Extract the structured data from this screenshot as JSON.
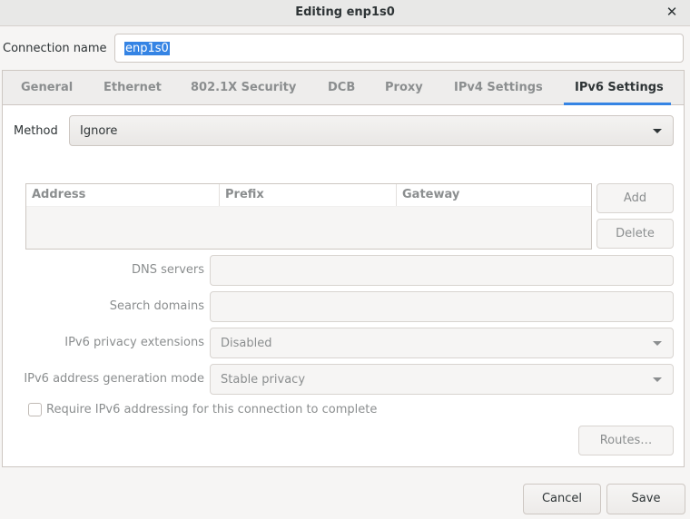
{
  "window": {
    "title": "Editing enp1s0"
  },
  "connection": {
    "label": "Connection name",
    "value": "enp1s0"
  },
  "tabs": [
    {
      "label": "General"
    },
    {
      "label": "Ethernet"
    },
    {
      "label": "802.1X Security"
    },
    {
      "label": "DCB"
    },
    {
      "label": "Proxy"
    },
    {
      "label": "IPv4 Settings"
    },
    {
      "label": "IPv6 Settings",
      "active": true
    }
  ],
  "method": {
    "label": "Method",
    "value": "Ignore"
  },
  "addresses": {
    "columns": [
      "Address",
      "Prefix",
      "Gateway"
    ],
    "add_label": "Add",
    "delete_label": "Delete"
  },
  "dns": {
    "label": "DNS servers",
    "value": ""
  },
  "search_domains": {
    "label": "Search domains",
    "value": ""
  },
  "privacy": {
    "label": "IPv6 privacy extensions",
    "value": "Disabled"
  },
  "addr_gen": {
    "label": "IPv6 address generation mode",
    "value": "Stable privacy"
  },
  "require": {
    "label": "Require IPv6 addressing for this connection to complete",
    "checked": false
  },
  "routes_label": "Routes…",
  "footer": {
    "cancel_label": "Cancel",
    "save_label": "Save"
  },
  "colors": {
    "accent": "#3584e4",
    "window_bg": "#f6f5f4",
    "text": "#2e3436",
    "dim_text": "#8b8e8f"
  },
  "icons": {
    "close": "close-icon",
    "dropdown": "chevron-down-icon"
  }
}
